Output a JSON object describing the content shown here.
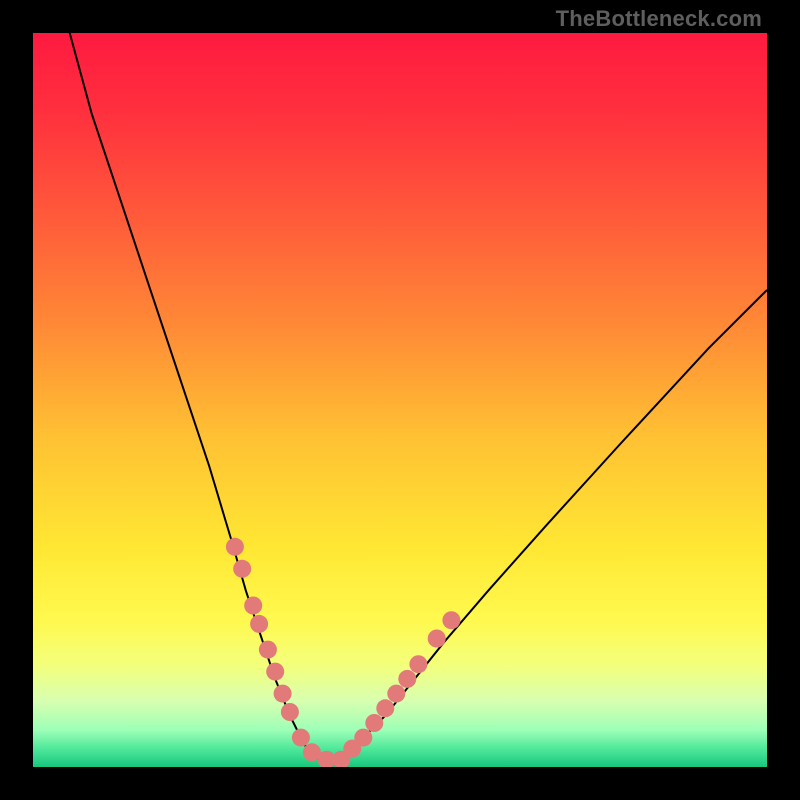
{
  "watermark": "TheBottleneck.com",
  "colors": {
    "bg_black": "#000000",
    "curve_stroke": "#000000",
    "dot_fill": "#e17a78",
    "gradient_stops": [
      {
        "offset": 0.0,
        "color": "#ff1a40"
      },
      {
        "offset": 0.1,
        "color": "#ff2e3e"
      },
      {
        "offset": 0.25,
        "color": "#ff5a3a"
      },
      {
        "offset": 0.4,
        "color": "#ff8a36"
      },
      {
        "offset": 0.55,
        "color": "#ffc133"
      },
      {
        "offset": 0.7,
        "color": "#ffe733"
      },
      {
        "offset": 0.8,
        "color": "#fff94f"
      },
      {
        "offset": 0.86,
        "color": "#f4ff7a"
      },
      {
        "offset": 0.91,
        "color": "#d8ffb0"
      },
      {
        "offset": 0.95,
        "color": "#9cffb7"
      },
      {
        "offset": 0.975,
        "color": "#4fe89a"
      },
      {
        "offset": 1.0,
        "color": "#17c77d"
      }
    ]
  },
  "chart_data": {
    "type": "line",
    "title": "",
    "xlabel": "",
    "ylabel": "",
    "xlim": [
      0,
      100
    ],
    "ylim": [
      0,
      100
    ],
    "series": [
      {
        "name": "bottleneck-curve",
        "x": [
          5,
          8,
          12,
          16,
          20,
          24,
          27,
          29,
          31,
          33,
          35,
          37,
          39,
          41,
          44,
          48,
          52,
          56,
          62,
          70,
          80,
          92,
          100
        ],
        "y": [
          100,
          89,
          77,
          65,
          53,
          41,
          31,
          24,
          18,
          12,
          7,
          3,
          1,
          1,
          3,
          7,
          12,
          17,
          24,
          33,
          44,
          57,
          65
        ]
      }
    ],
    "highlight_points": {
      "name": "marked-dots",
      "x": [
        27.5,
        28.5,
        30.0,
        30.8,
        32.0,
        33.0,
        34.0,
        35.0,
        36.5,
        38.0,
        40.0,
        42.0,
        43.5,
        45.0,
        46.5,
        48.0,
        49.5,
        51.0,
        52.5,
        55.0,
        57.0
      ],
      "y": [
        30.0,
        27.0,
        22.0,
        19.5,
        16.0,
        13.0,
        10.0,
        7.5,
        4.0,
        2.0,
        1.0,
        1.0,
        2.5,
        4.0,
        6.0,
        8.0,
        10.0,
        12.0,
        14.0,
        17.5,
        20.0
      ]
    }
  }
}
